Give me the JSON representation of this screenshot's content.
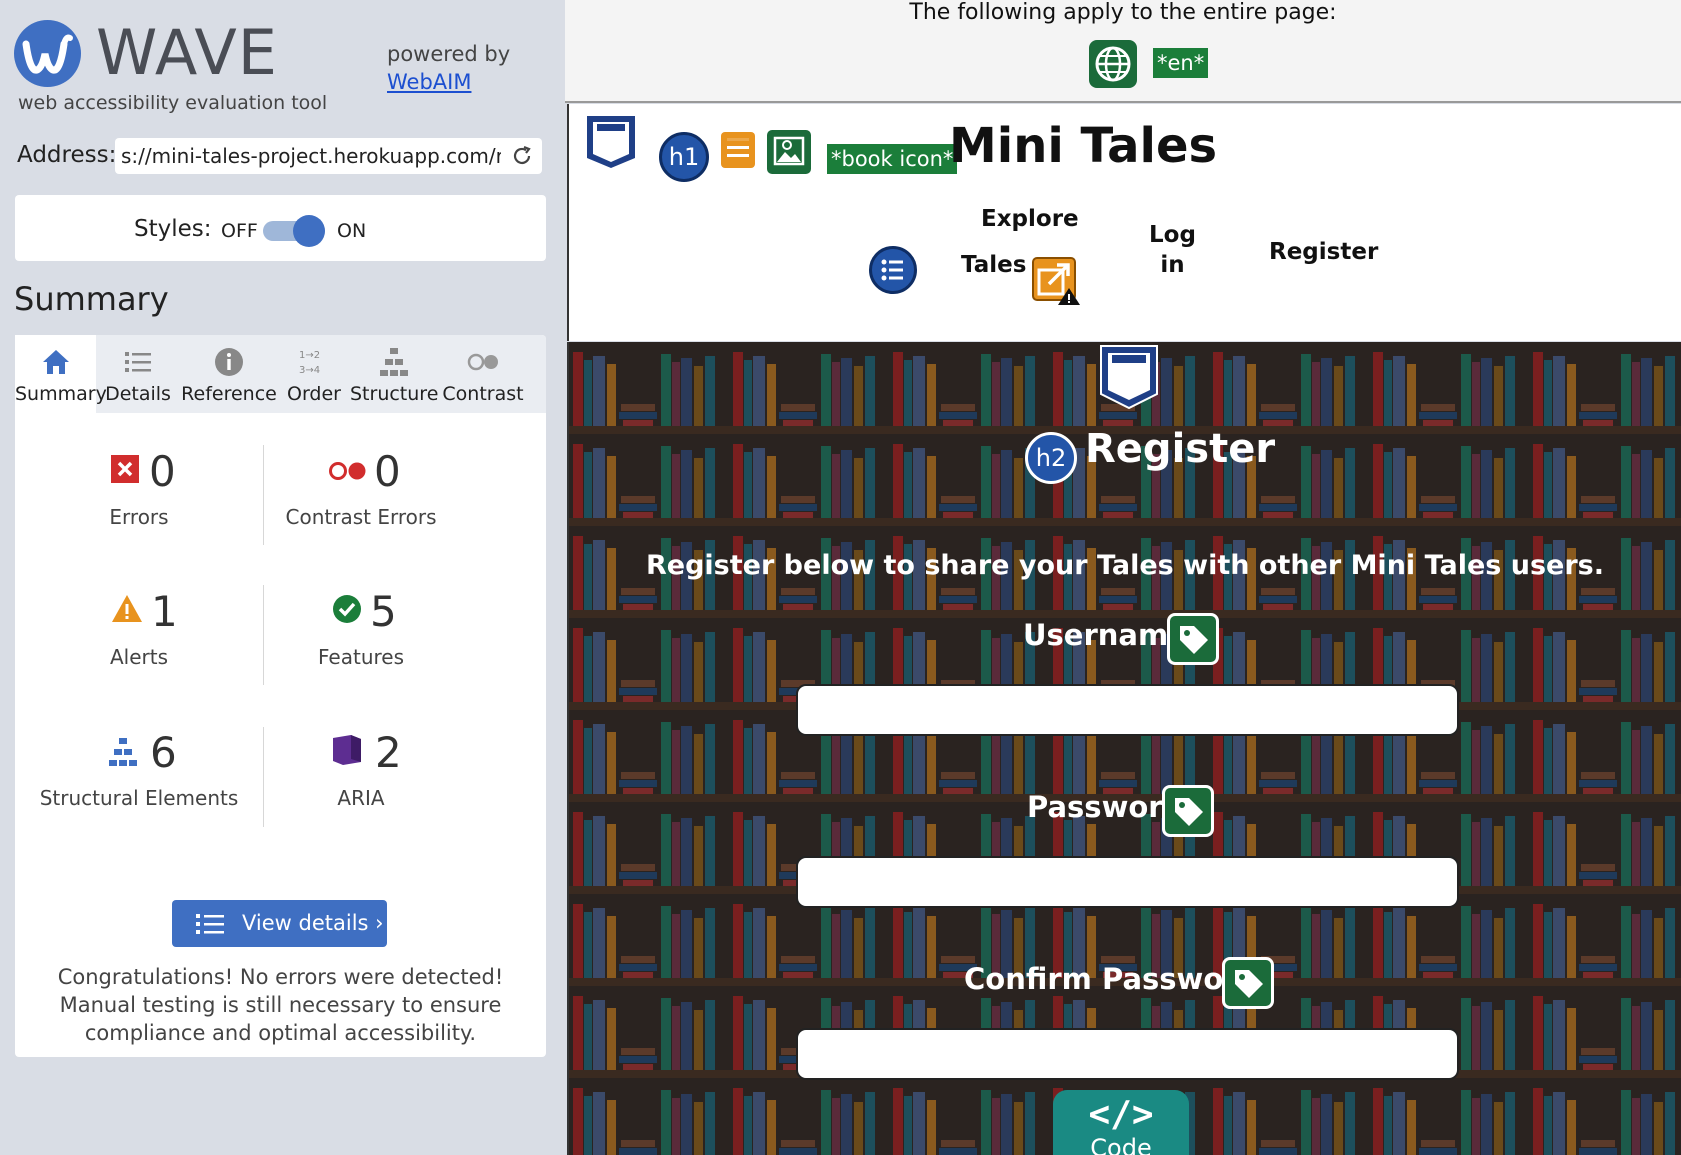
{
  "wave": {
    "title": "WAVE",
    "subtitle": "web accessibility evaluation tool",
    "powered_by": "powered by",
    "powered_link": "WebAIM"
  },
  "address": {
    "label": "Address:",
    "value": "s://mini-tales-project.herokuapp.com/regis"
  },
  "styles": {
    "label": "Styles:",
    "off": "OFF",
    "on": "ON",
    "enabled": true
  },
  "summary_heading": "Summary",
  "tabs": [
    {
      "label": "Summary",
      "icon": "home-icon",
      "active": true
    },
    {
      "label": "Details",
      "icon": "list-icon",
      "active": false
    },
    {
      "label": "Reference",
      "icon": "info-icon",
      "active": false
    },
    {
      "label": "Order",
      "icon": "order-icon",
      "active": false
    },
    {
      "label": "Structure",
      "icon": "structure-icon",
      "active": false
    },
    {
      "label": "Contrast",
      "icon": "contrast-icon",
      "active": false
    }
  ],
  "stats": {
    "errors": {
      "count": "0",
      "label": "Errors",
      "icon": "error-x-icon"
    },
    "contrast": {
      "count": "0",
      "label": "Contrast Errors",
      "icon": "contrast-error-icon"
    },
    "alerts": {
      "count": "1",
      "label": "Alerts",
      "icon": "alert-triangle-icon"
    },
    "features": {
      "count": "5",
      "label": "Features",
      "icon": "feature-check-icon"
    },
    "structure": {
      "count": "6",
      "label": "Structural Elements",
      "icon": "structure-tree-icon"
    },
    "aria": {
      "count": "2",
      "label": "ARIA",
      "icon": "aria-cube-icon"
    }
  },
  "view_details": "View details ›",
  "congrats": "Congratulations! No errors were detected! Manual testing is still necessary to ensure compliance and optimal accessibility.",
  "colors": {
    "wave_blue": "#3f6fc2",
    "feature_green": "#1b7e3a",
    "error_red": "#d12d2d",
    "alert_orange": "#e8931e",
    "aria_purple": "#5d2d91",
    "code_teal": "#1a8a83"
  },
  "page": {
    "notice": "The following apply to the entire page:",
    "lang": "*en*",
    "h1_badge": "h1",
    "book_badge": "*book icon*",
    "site_title": "Mini Tales",
    "nav": {
      "explore_1": "Explore",
      "explore_2": "Tales",
      "login_1": "Log",
      "login_2": "in",
      "register": "Register"
    },
    "h2_badge": "h2",
    "heading": "Register",
    "subheading": "Register below to share your Tales with other Mini Tales users.",
    "fields": {
      "username": "Username",
      "password": "Password",
      "confirm": "Confirm Password"
    },
    "code_glyph": "</>",
    "code_label": "Code"
  }
}
